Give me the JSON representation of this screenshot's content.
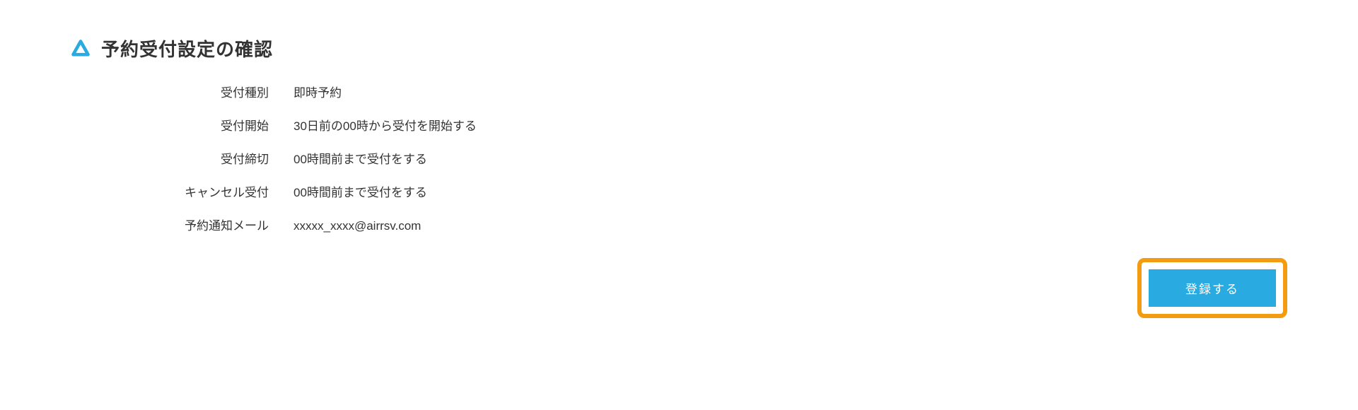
{
  "header": {
    "title": "予約受付設定の確認"
  },
  "settings": [
    {
      "label": "受付種別",
      "value": "即時予約"
    },
    {
      "label": "受付開始",
      "value": "30日前の00時から受付を開始する"
    },
    {
      "label": "受付締切",
      "value": "00時間前まで受付をする"
    },
    {
      "label": "キャンセル受付",
      "value": "00時間前まで受付をする"
    },
    {
      "label": "予約通知メール",
      "value": "xxxxx_xxxx@airrsv.com"
    }
  ],
  "actions": {
    "register_label": "登録する"
  },
  "colors": {
    "accent": "#29abe2",
    "highlight": "#f39c12"
  }
}
